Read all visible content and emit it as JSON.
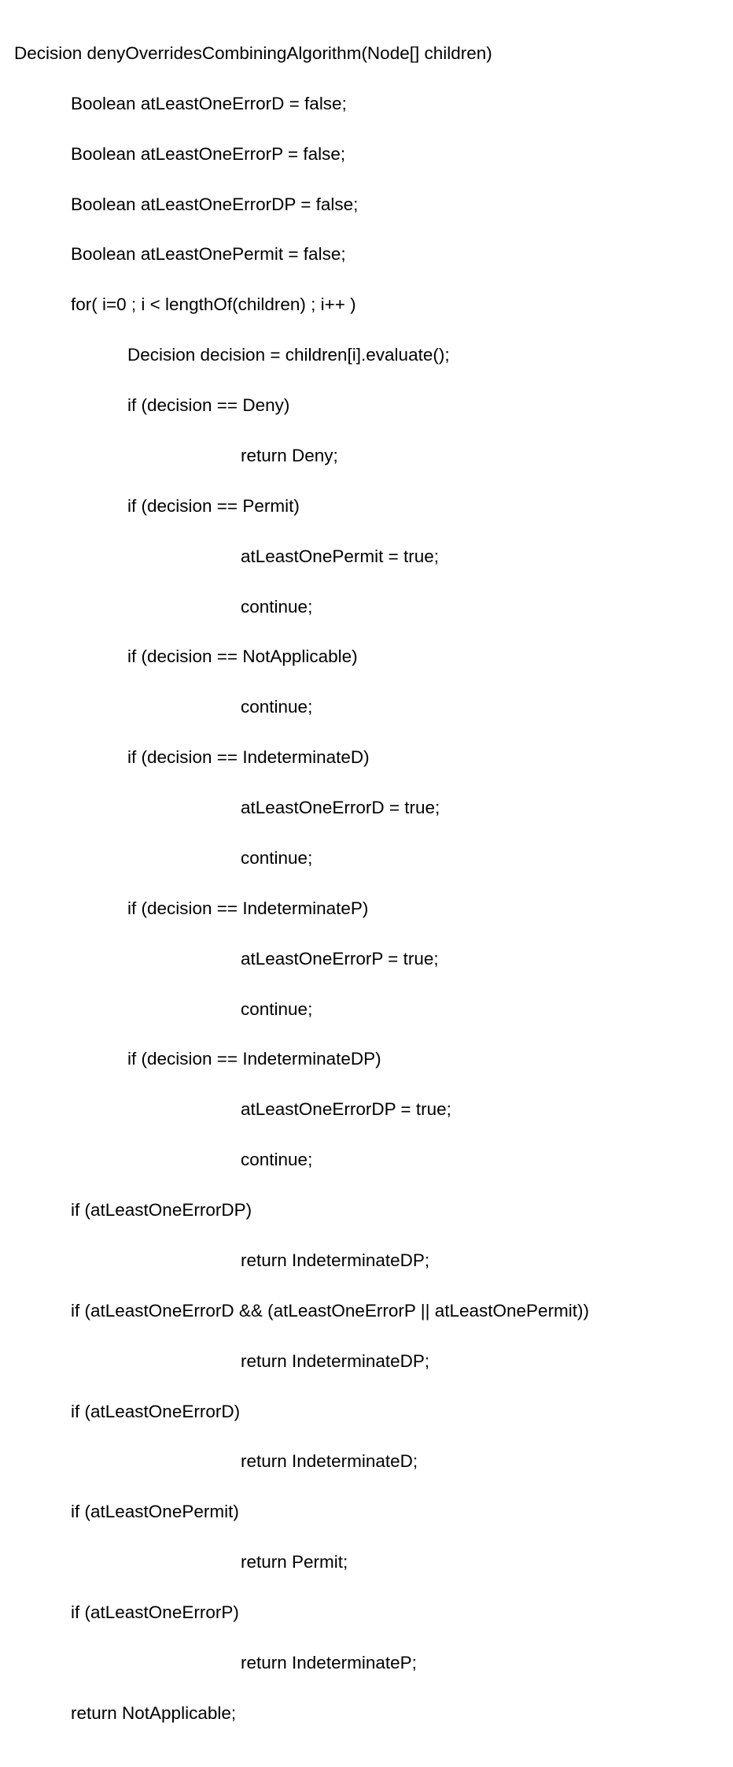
{
  "code": {
    "l01": "Decision denyOverridesCombiningAlgorithm(Node[] children)",
    "l02": "Boolean atLeastOneErrorD = false;",
    "l03": "Boolean atLeastOneErrorP = false;",
    "l04": "Boolean atLeastOneErrorDP = false;",
    "l05": "Boolean atLeastOnePermit = false;",
    "l06": "for( i=0 ; i < lengthOf(children) ; i++ )",
    "l07": "Decision decision = children[i].evaluate();",
    "l08": "if (decision == Deny)",
    "l09": "return Deny;",
    "l10": "if (decision == Permit)",
    "l11": "atLeastOnePermit = true;",
    "l12": "continue;",
    "l13": "if (decision == NotApplicable)",
    "l14": "continue;",
    "l15": "if (decision == IndeterminateD)",
    "l16": "atLeastOneErrorD = true;",
    "l17": "continue;",
    "l18": "if (decision == IndeterminateP)",
    "l19": "atLeastOneErrorP = true;",
    "l20": "continue;",
    "l21": "if (decision == IndeterminateDP)",
    "l22": "atLeastOneErrorDP = true;",
    "l23": "continue;",
    "l24": "if (atLeastOneErrorDP)",
    "l25": "return IndeterminateDP;",
    "l26": "if (atLeastOneErrorD && (atLeastOneErrorP || atLeastOnePermit))",
    "l27": "return IndeterminateDP;",
    "l28": "if (atLeastOneErrorD)",
    "l29": "return IndeterminateD;",
    "l30": "if (atLeastOnePermit)",
    "l31": "return Permit;",
    "l32": "if (atLeastOneErrorP)",
    "l33": "return IndeterminateP;",
    "l34": "return NotApplicable;"
  }
}
